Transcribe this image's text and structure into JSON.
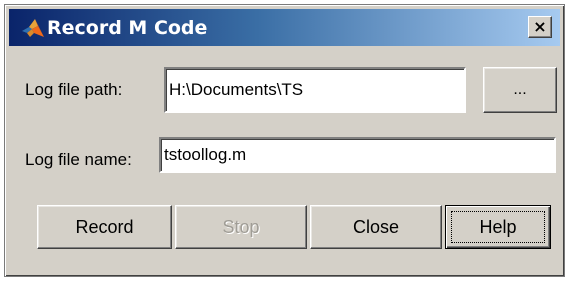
{
  "window": {
    "title": "Record M Code",
    "close_glyph": "×",
    "icon": "matlab-logo-icon"
  },
  "form": {
    "path_label": "Log file path:",
    "path_value": "H:\\Documents\\TS",
    "browse_label": "...",
    "name_label": "Log file name:",
    "name_value": "tstoollog.m"
  },
  "buttons": {
    "record_label": "Record",
    "stop_label": "Stop",
    "stop_enabled": false,
    "close_label": "Close",
    "help_label": "Help",
    "focused": "help"
  },
  "colors": {
    "titlebar_start": "#0a246a",
    "titlebar_end": "#a6caf0",
    "dialog_face": "#d4d0c8"
  }
}
